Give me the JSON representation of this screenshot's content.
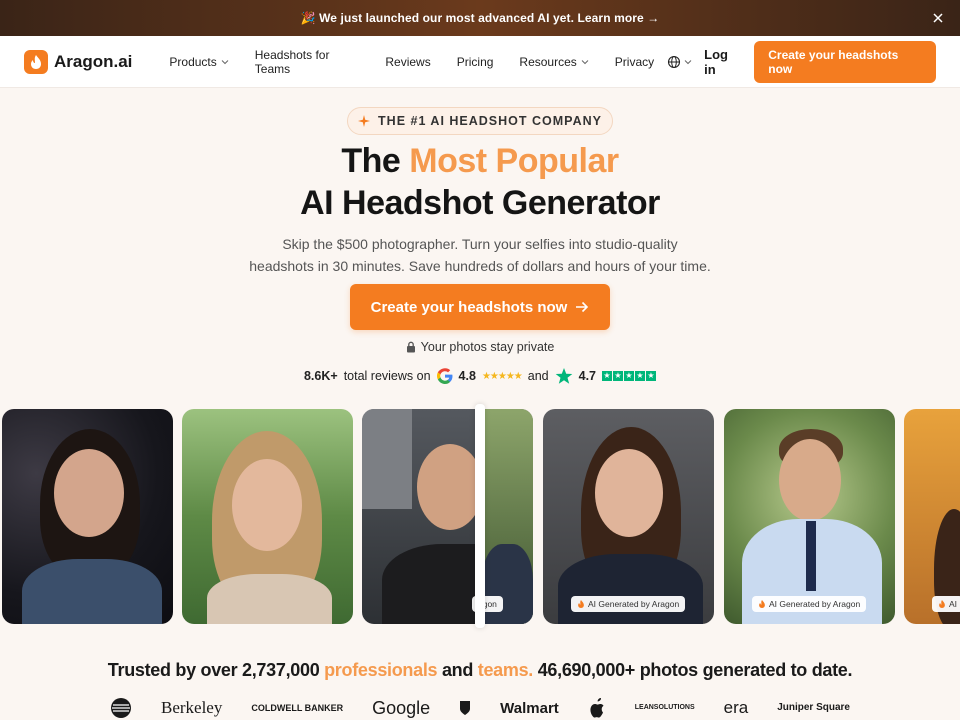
{
  "banner": {
    "text": "🎉 We just launched our most advanced AI yet. Learn more →"
  },
  "nav": {
    "brand": "Aragon.ai",
    "items": [
      {
        "label": "Products",
        "dropdown": true
      },
      {
        "label": "Headshots for Teams",
        "dropdown": false
      },
      {
        "label": "Reviews",
        "dropdown": false
      },
      {
        "label": "Pricing",
        "dropdown": false
      },
      {
        "label": "Resources",
        "dropdown": true
      },
      {
        "label": "Privacy",
        "dropdown": false
      }
    ],
    "login": "Log in",
    "cta": "Create your headshots now"
  },
  "hero": {
    "badge": "THE #1 AI HEADSHOT COMPANY",
    "title_pre": "The ",
    "title_accent": "Most Popular",
    "title_line2": "AI Headshot Generator",
    "sub_line1": "Skip the $500 photographer. Turn your selfies into studio-quality",
    "sub_line2": "headshots in 30 minutes. Save hundreds of dollars and hours of your time.",
    "cta": "Create your headshots now",
    "private": "Your photos stay private"
  },
  "reviews": {
    "count": "8.6K+",
    "label": "total reviews on",
    "google_rating": "4.8",
    "and": "and",
    "trustpilot_rating": "4.7"
  },
  "photos": {
    "tag": "AI Generated by Aragon",
    "tag_partial_left": "agon",
    "tag_partial_right": "AI"
  },
  "trusted": {
    "pre": "Trusted by over 2,737,000 ",
    "professionals": "professionals",
    "and": " and ",
    "teams": "teams.",
    "post": " 46,690,000+ photos generated to date."
  },
  "logos": [
    "Berkeley",
    "COLDWELL BANKER",
    "Google",
    "Walmart",
    "LEANSOLUTIONS",
    "era",
    "Juniper Square"
  ],
  "colors": {
    "accent": "#f47c20",
    "accent_light": "#f59a4e",
    "background": "#fbf6f2",
    "trustpilot": "#00b67a"
  }
}
